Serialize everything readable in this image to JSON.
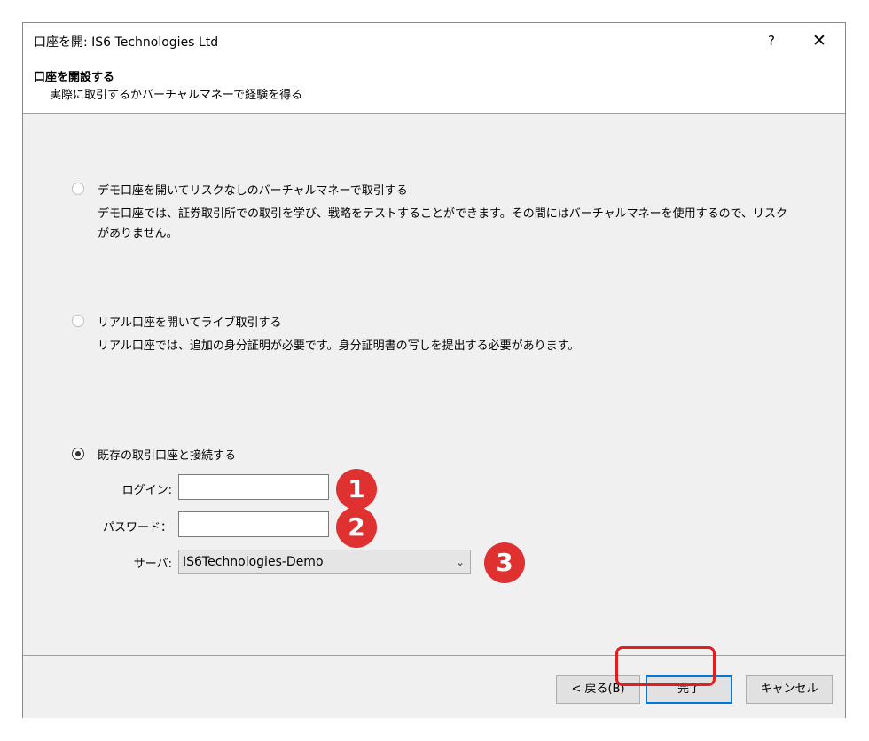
{
  "window": {
    "title": "口座を開: IS6 Technologies Ltd",
    "help_label": "?",
    "close_label": "✕"
  },
  "header": {
    "title": "口座を開設する",
    "subtitle": "実際に取引するかバーチャルマネーで経験を得る"
  },
  "options": [
    {
      "label": "デモ口座を開いてリスクなしのバーチャルマネーで取引する",
      "description": "デモ口座では、証券取引所での取引を学び、戦略をテストすることができます。その間にはバーチャルマネーを使用するので、リスクがありません。",
      "selected": false
    },
    {
      "label": "リアル口座を開いてライブ取引する",
      "description": "リアル口座では、追加の身分証明が必要です。身分証明書の写しを提出する必要があります。",
      "selected": false
    },
    {
      "label": "既存の取引口座と接続する",
      "selected": true
    }
  ],
  "form": {
    "login_label": "ログイン:",
    "login_value": "",
    "password_label": "パスワード：",
    "password_value": "",
    "server_label": "サーバ:",
    "server_value": "IS6Technologies-Demo"
  },
  "badges": [
    "1",
    "2",
    "3"
  ],
  "footer": {
    "back_label": "< 戻る(B)",
    "finish_label": "完了",
    "cancel_label": "キャンセル"
  },
  "colors": {
    "badge": "#e03131",
    "highlight": "#e02020",
    "primary_border": "#0078d7",
    "panel_bg": "#f0f0f0"
  }
}
